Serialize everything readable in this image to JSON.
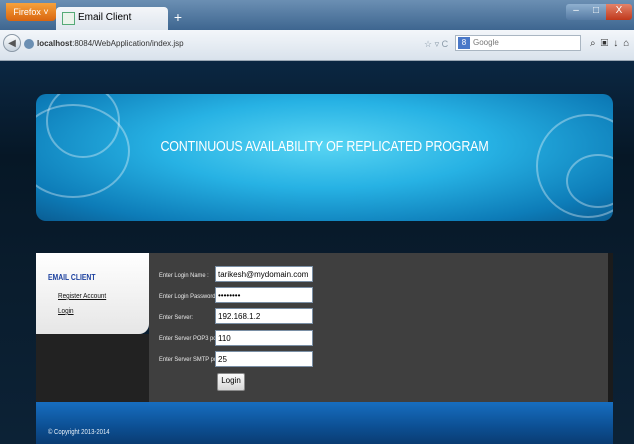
{
  "browser": {
    "menu_label": "Firefox ˅",
    "tab_title": "Email Client",
    "new_tab_icon": "plus-icon",
    "url_host": "localhost",
    "url_rest": ":8084/WebApplication/index.jsp",
    "url_icons": "☆ ▿ C",
    "search_engine": "Google",
    "search_placeholder": "Google",
    "window_buttons": {
      "minimize": "–",
      "maximize": "□",
      "close": "X"
    }
  },
  "banner": {
    "title": "CONTINUOUS AVAILABILITY OF REPLICATED PROGRAM"
  },
  "sidebar": {
    "title": "EMAIL CLIENT",
    "links": [
      "Register Account",
      "Login"
    ]
  },
  "form": {
    "login_name": {
      "label": "Enter Login Name :",
      "value": "tarikesh@mydomain.com"
    },
    "password": {
      "label": "Enter Login Password :",
      "value": "••••••••"
    },
    "server": {
      "label": "Enter Server:",
      "value": "192.168.1.2"
    },
    "pop3_port": {
      "label": "Enter Server POP3 port::",
      "value": "110"
    },
    "smtp_port": {
      "label": "Enter Server SMTP port::",
      "value": "25"
    },
    "submit_label": "Login"
  },
  "footer": {
    "copyright": "© Copyright 2013-2014"
  },
  "colors": {
    "banner": "#27b2e4",
    "sidebar_title": "#1a3f9e",
    "form_panel": "#3f3f3f",
    "footer": "#0c4f93"
  }
}
